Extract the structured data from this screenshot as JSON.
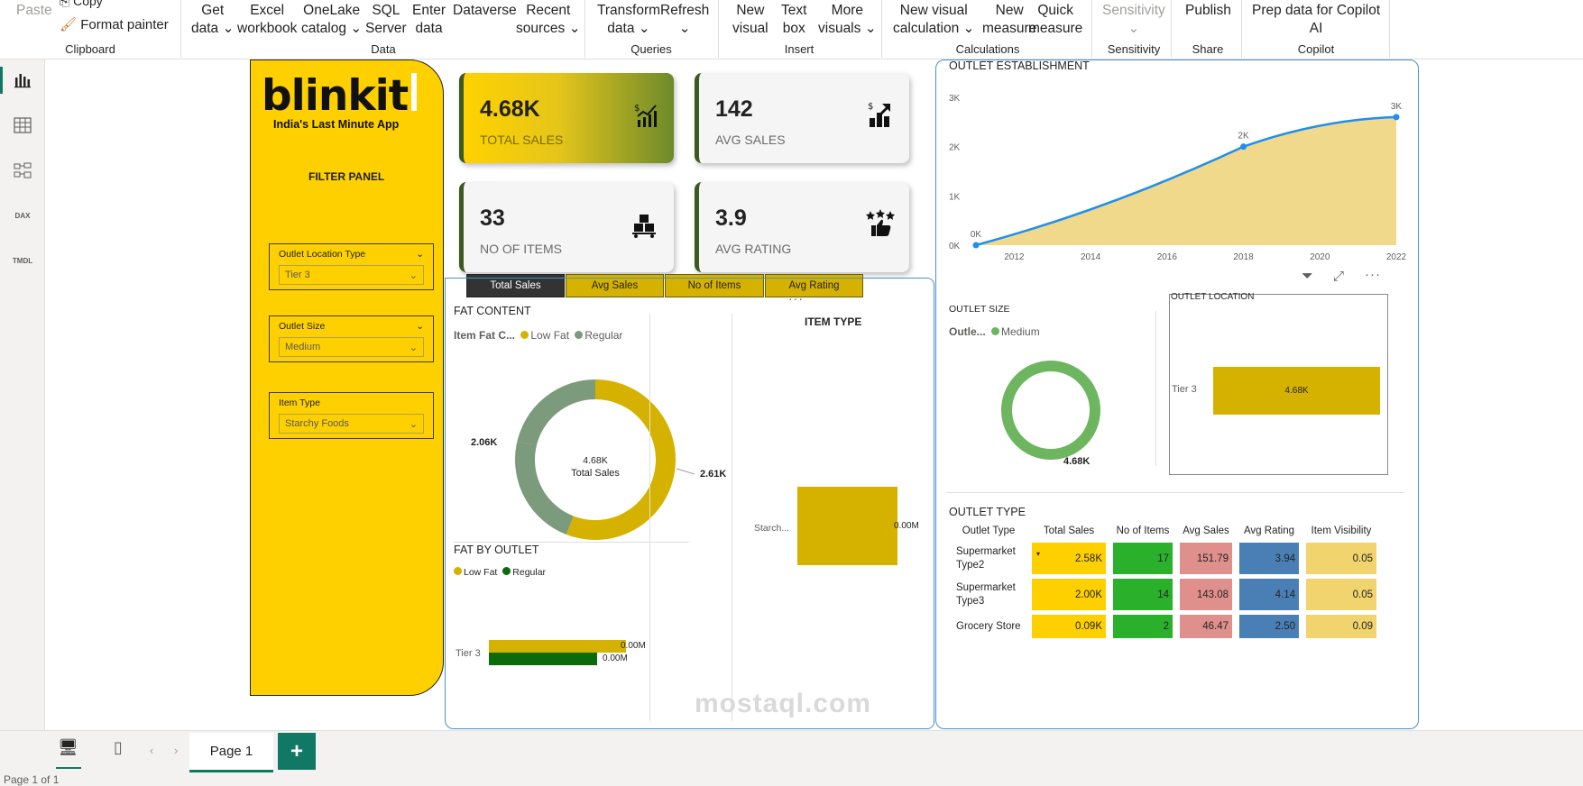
{
  "ribbon": {
    "paste": "Paste",
    "copy": "Copy",
    "format_painter": "Format painter",
    "groups": {
      "clipboard": "Clipboard",
      "data": "Data",
      "queries": "Queries",
      "insert": "Insert",
      "calculations": "Calculations",
      "sensitivity": "Sensitivity",
      "share": "Share",
      "copilot": "Copilot"
    },
    "buttons": {
      "get_data_1": "Get",
      "get_data_2": "data",
      "excel_1": "Excel",
      "excel_2": "workbook",
      "onelake_1": "OneLake",
      "onelake_2": "catalog",
      "sql_1": "SQL",
      "sql_2": "Server",
      "enter_1": "Enter",
      "enter_2": "data",
      "dataverse": "Dataverse",
      "recent_1": "Recent",
      "recent_2": "sources",
      "transform_1": "Transform",
      "transform_2": "data",
      "refresh": "Refresh",
      "new_visual_1": "New",
      "new_visual_2": "visual",
      "text_box_1": "Text",
      "text_box_2": "box",
      "more_visuals_1": "More",
      "more_visuals_2": "visuals",
      "new_calc_1": "New visual",
      "new_calc_2": "calculation",
      "new_measure_1": "New",
      "new_measure_2": "measure",
      "quick_measure_1": "Quick",
      "quick_measure_2": "measure",
      "sensitivity": "Sensitivity",
      "publish": "Publish",
      "prep_1": "Prep data for Copilot",
      "prep_2": "AI"
    }
  },
  "filter_panel": {
    "logo": "blinkit",
    "tagline": "India's Last Minute App",
    "title": "FILTER PANEL",
    "slicers": [
      {
        "label": "Outlet Location Type",
        "value": "Tier 3"
      },
      {
        "label": "Outlet Size",
        "value": "Medium"
      },
      {
        "label": "Item Type",
        "value": "Starchy Foods"
      }
    ]
  },
  "kpis": [
    {
      "value": "4.68K",
      "label": "TOTAL SALES",
      "icon": "chart-growth-icon"
    },
    {
      "value": "142",
      "label": "AVG SALES",
      "icon": "bar-growth-icon"
    },
    {
      "value": "33",
      "label": "NO OF ITEMS",
      "icon": "boxes-icon"
    },
    {
      "value": "3.9",
      "label": "AVG RATING",
      "icon": "thumbs-up-stars-icon"
    }
  ],
  "measure_buttons": [
    "Total Sales",
    "Avg Sales",
    "No of Items",
    "Avg Rating"
  ],
  "fat_content": {
    "title": "FAT CONTENT",
    "legend_title": "Item Fat C...",
    "legend": [
      "Low Fat",
      "Regular"
    ],
    "center_value": "4.68K",
    "center_label": "Total Sales",
    "label_low": "2.61K",
    "label_regular": "2.06K",
    "chart_data": {
      "type": "pie",
      "categories": [
        "Low Fat",
        "Regular"
      ],
      "values": [
        2610,
        2060
      ]
    }
  },
  "item_type": {
    "title": "ITEM TYPE",
    "category": "Starch...",
    "value_label": "0.00M"
  },
  "fat_by_outlet": {
    "title": "FAT BY OUTLET",
    "legend": [
      "Low Fat",
      "Regular"
    ],
    "category": "Tier 3",
    "label_low": "0.00M",
    "label_regular": "0.00M"
  },
  "outlet_establishment": {
    "title": "OUTLET ESTABLISHMENT",
    "y_ticks": [
      "3K",
      "2K",
      "1K",
      "0K"
    ],
    "x_ticks": [
      "2012",
      "2014",
      "2016",
      "2018",
      "2020",
      "2022"
    ],
    "point_labels": [
      "0K",
      "2K",
      "3K"
    ],
    "chart_data": {
      "type": "area",
      "x": [
        2011,
        2018,
        2022
      ],
      "values": [
        0,
        2000,
        2600
      ],
      "ylim": [
        0,
        3000
      ]
    }
  },
  "outlet_size": {
    "title": "OUTLET SIZE",
    "legend_title": "Outle...",
    "legend": [
      "Medium"
    ],
    "value_label": "4.68K",
    "chart_data": {
      "type": "pie",
      "categories": [
        "Medium"
      ],
      "values": [
        4680
      ]
    }
  },
  "outlet_location": {
    "title": "OUTLET LOCATION",
    "category": "Tier 3",
    "value_label": "4.68K",
    "chart_data": {
      "type": "bar",
      "categories": [
        "Tier 3"
      ],
      "values": [
        4680
      ]
    }
  },
  "outlet_type": {
    "title": "OUTLET TYPE",
    "headers": [
      "Outlet Type",
      "Total Sales",
      "No of Items",
      "Avg Sales",
      "Avg Rating",
      "Item Visibility"
    ],
    "rows": [
      {
        "type": "Supermarket Type2",
        "sales": "2.58K",
        "items": "17",
        "avg": "151.79",
        "rating": "3.94",
        "vis": "0.05"
      },
      {
        "type": "Supermarket Type3",
        "sales": "2.00K",
        "items": "14",
        "avg": "143.08",
        "rating": "4.14",
        "vis": "0.05"
      },
      {
        "type": "Grocery Store",
        "sales": "0.09K",
        "items": "2",
        "avg": "46.47",
        "rating": "2.50",
        "vis": "0.09"
      }
    ]
  },
  "colors": {
    "yellow": "#fed000",
    "gold": "#d6b200",
    "gray_green": "#7b9b7c",
    "dark_green": "#0b6b0b",
    "line_blue": "#1f8ef1",
    "area_fill": "#f0d98a",
    "medium_green": "#6db55f"
  },
  "page_tab": "Page 1",
  "status": "Page 1 of 1",
  "watermark": "mostaql.com"
}
